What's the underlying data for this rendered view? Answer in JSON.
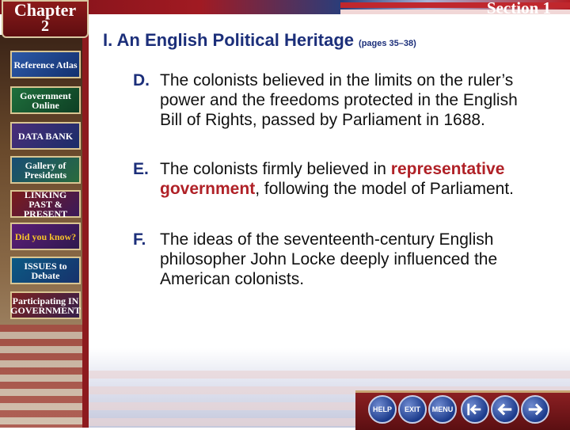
{
  "header": {
    "chapter_word": "Chapter",
    "chapter_number": "2",
    "section": "Section 1"
  },
  "sidebar": {
    "items": [
      {
        "label": "Reference Atlas",
        "icon": "atlas-icon"
      },
      {
        "label": "Government Online",
        "icon": "government-online-icon"
      },
      {
        "label": "DATA BANK",
        "icon": "data-bank-icon"
      },
      {
        "label": "Gallery of Presidents",
        "icon": "presidents-icon"
      },
      {
        "label": "LINKING PAST & PRESENT",
        "icon": "linking-icon"
      },
      {
        "label": "Did you know?",
        "icon": "question-icon"
      },
      {
        "label": "ISSUES to Debate",
        "icon": "issues-icon"
      },
      {
        "label": "Participating IN GOVERNMENT",
        "icon": "participating-icon"
      }
    ]
  },
  "content": {
    "heading": "I.  An English Political Heritage",
    "pages": "(pages 35–38)",
    "items": [
      {
        "letter": "D.",
        "text": "The colonists believed in the limits on the ruler’s power and the freedoms protected in the English Bill of Rights, passed by Parliament in 1688."
      },
      {
        "letter": "E.",
        "pre": "The colonists firmly believed in ",
        "term": "representative government",
        "post": ", following the model of Parliament."
      },
      {
        "letter": "F.",
        "text": "The ideas of the seventeenth-century English philosopher John Locke deeply influenced the American colonists."
      }
    ]
  },
  "footer": {
    "help": "HELP",
    "exit": "EXIT",
    "menu": "MENU",
    "prev_icon": "previous-arrow-icon",
    "back_icon": "back-arrow-icon",
    "next_icon": "next-arrow-icon"
  },
  "colors": {
    "heading": "#1c2f7a",
    "term": "#b02127",
    "banner_red": "#8d1a1e"
  }
}
